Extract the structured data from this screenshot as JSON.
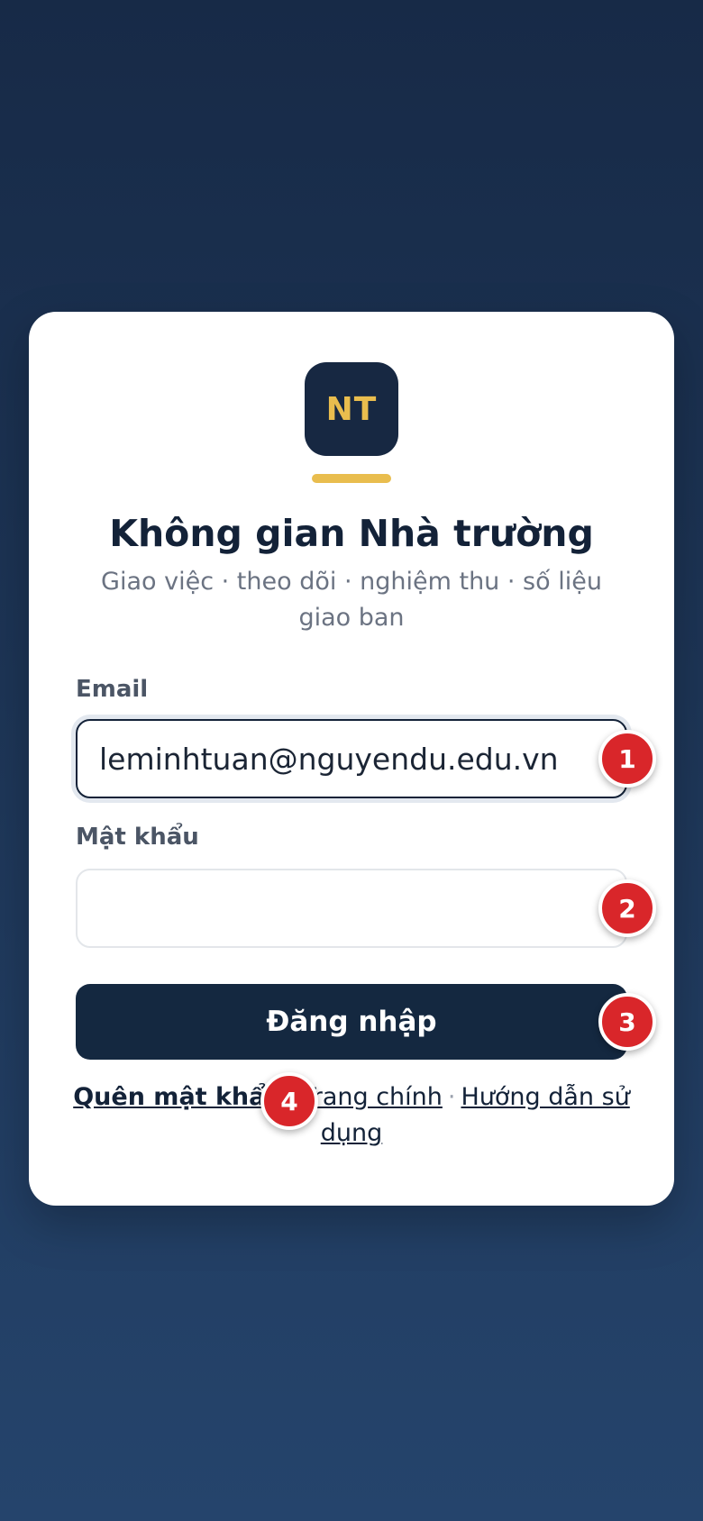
{
  "logo": {
    "initials": "NT"
  },
  "header": {
    "title": "Không gian Nhà trường",
    "subtitle": "Giao việc · theo dõi · nghiệm thu · số liệu giao ban"
  },
  "form": {
    "email_label": "Email",
    "email_value": "leminhtuan@nguyendu.edu.vn",
    "password_label": "Mật khẩu",
    "password_value": "",
    "login_label": "Đăng nhập"
  },
  "links": {
    "forgot_password": "Quên mật khẩu",
    "separator": "·",
    "home": "Trang chính",
    "guide": "Hướng dẫn sử dụng"
  },
  "badges": [
    "1",
    "2",
    "3",
    "4"
  ],
  "colors": {
    "background_top": "#172a47",
    "background_bottom": "#25446c",
    "card": "#ffffff",
    "accent_gold": "#e9bd4e",
    "navy": "#142840",
    "badge_red": "#d9262a"
  }
}
